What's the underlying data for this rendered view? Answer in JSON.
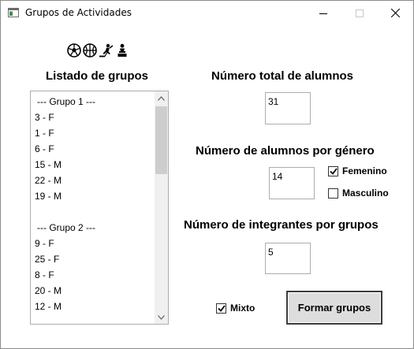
{
  "window": {
    "title": "Grupos de Actividades"
  },
  "icons": [
    "soccer-ball-icon",
    "basketball-icon",
    "hockey-player-icon",
    "chess-piece-icon"
  ],
  "left_panel": {
    "heading": "Listado de grupos",
    "items": [
      {
        "text": "--- Grupo 1 ---",
        "header": true
      },
      {
        "text": "3 - F"
      },
      {
        "text": "1 - F"
      },
      {
        "text": "6 - F"
      },
      {
        "text": "15 - M"
      },
      {
        "text": "22 - M"
      },
      {
        "text": "19 - M"
      },
      {
        "text": ""
      },
      {
        "text": "--- Grupo 2 ---",
        "header": true
      },
      {
        "text": "9 - F"
      },
      {
        "text": "25 - F"
      },
      {
        "text": "8 - F"
      },
      {
        "text": "20 - M"
      },
      {
        "text": "12 - M"
      }
    ]
  },
  "total": {
    "heading": "Número total de alumnos",
    "value": "31"
  },
  "gender": {
    "heading": "Número de alumnos por género",
    "value": "14",
    "femenino_label": "Femenino",
    "femenino_checked": true,
    "masculino_label": "Masculino",
    "masculino_checked": false
  },
  "per_group": {
    "heading": "Número de integrantes por grupos",
    "value": "5"
  },
  "mixto": {
    "label": "Mixto",
    "checked": true
  },
  "form_button": "Formar grupos"
}
